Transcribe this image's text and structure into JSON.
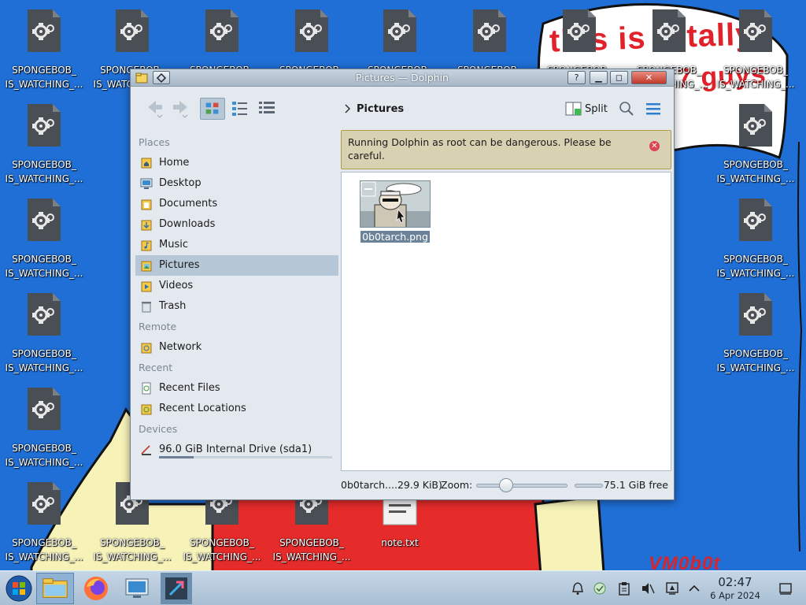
{
  "wallpaper": {
    "scrawl_top": "this is totally",
    "scrawl_mid": "",
    "scrawl_second": "7 guys",
    "signature": "VM0b0t"
  },
  "desktop": {
    "icons": [
      {
        "label": "SPONGEBOB_\nIS_WATCHING_...",
        "kind": "file-gear"
      },
      {
        "label": "SPONGEBOB_\nIS_WATCHING_...",
        "kind": "file-gear"
      },
      {
        "label": "SPONGEBOB_\nIS_WATCHING_...",
        "kind": "file-gear"
      },
      {
        "label": "SPONGEBOB_\nIS_WATCHING_...",
        "kind": "file-gear"
      },
      {
        "label": "SPONGEBOB_\nIS_WATCHING_...",
        "kind": "file-gear"
      },
      {
        "label": "SPONGEBOB_\nIS_WATCHING_...",
        "kind": "file-gear"
      },
      {
        "label": "SPONGEBOB_\nIS_WATCHING_...",
        "kind": "file-gear"
      },
      {
        "label": "SPONGEBOB_\nIS_WATCHING_...",
        "kind": "file-gear"
      },
      {
        "label": "SPONGEBOB_\nIS_WATCHING_...",
        "kind": "file-gear"
      },
      {
        "label": "SPONGEBOB_\nIS_WATCHING_...",
        "kind": "file-gear"
      },
      {
        "label": "SPONGEBOB_\nIS_WATCHING_...",
        "kind": "file-gear"
      },
      {
        "label": "SPONGEBOB_\nIS_WATCHING_...",
        "kind": "file-gear"
      },
      {
        "label": "SPONGEBOB_\nIS_WATCHING_...",
        "kind": "file-gear"
      },
      {
        "label": "SPONGEBOB_\nIS_WATCHING_...",
        "kind": "file-gear"
      },
      {
        "label": "SPONGEBOB_\nIS_WATCHING_...",
        "kind": "file-gear"
      },
      {
        "label": "SPONGEBOB_\nIS_WATCHING_...",
        "kind": "file-gear"
      },
      {
        "label": "SPONGEBOB_\nIS_WATCHING_...",
        "kind": "file-gear"
      },
      {
        "label": "SPONGEBOB_\nIS_WATCHING_...",
        "kind": "file-gear"
      },
      {
        "label": "SPONGEBOB_\nIS_WATCHING_...",
        "kind": "file-gear"
      },
      {
        "label": "SPONGEBOB_\nIS_WATCHING_...",
        "kind": "file-gear"
      },
      {
        "label": "note.txt",
        "kind": "text-file"
      }
    ]
  },
  "window": {
    "title": "Pictures — Dolphin",
    "buttons": {
      "help": "?",
      "minimize": "▁",
      "maximize": "◻",
      "close": "✕"
    }
  },
  "toolbar": {
    "breadcrumb": "Pictures",
    "split_label": "Split",
    "icons": [
      "back-icon",
      "forward-icon",
      "icons-view-icon",
      "compact-view-icon",
      "details-view-icon",
      "split-icon",
      "search-icon",
      "menu-icon"
    ]
  },
  "places": {
    "groups": [
      {
        "title": "Places",
        "items": [
          {
            "label": "Home",
            "icon": "home-icon"
          },
          {
            "label": "Desktop",
            "icon": "desktop-icon"
          },
          {
            "label": "Documents",
            "icon": "documents-folder-icon"
          },
          {
            "label": "Downloads",
            "icon": "downloads-folder-icon"
          },
          {
            "label": "Music",
            "icon": "music-folder-icon"
          },
          {
            "label": "Pictures",
            "icon": "pictures-folder-icon",
            "selected": true
          },
          {
            "label": "Videos",
            "icon": "videos-folder-icon"
          },
          {
            "label": "Trash",
            "icon": "trash-icon"
          }
        ]
      },
      {
        "title": "Remote",
        "items": [
          {
            "label": "Network",
            "icon": "network-folder-icon"
          }
        ]
      },
      {
        "title": "Recent",
        "items": [
          {
            "label": "Recent Files",
            "icon": "recent-files-icon"
          },
          {
            "label": "Recent Locations",
            "icon": "recent-locations-icon"
          }
        ]
      },
      {
        "title": "Devices",
        "items": [
          {
            "label": "96.0 GiB Internal Drive (sda1)",
            "icon": "drive-icon",
            "usage_fraction": 0.2
          }
        ]
      }
    ]
  },
  "banner": {
    "message": "Running Dolphin as root can be dangerous. Please be careful.",
    "color": "#d8d1b2"
  },
  "files": [
    {
      "name": "0b0tarch.png"
    }
  ],
  "statusbar": {
    "selection": "0b0tarch....29.9 KiB)",
    "zoom_label": "Zoom:",
    "zoom_fraction": 0.3,
    "free_space": "75.1 GiB free"
  },
  "taskbar": {
    "apps": [
      "start-menu-icon",
      "file-manager-icon",
      "firefox-icon",
      "system-settings-icon",
      "discover-icon"
    ],
    "tray": [
      "notifications-icon",
      "clipboard-icon",
      "klipper-icon",
      "volume-muted-icon",
      "monitor-icon",
      "expand-tray-icon"
    ],
    "clock_time": "02:47",
    "clock_date": "6 Apr 2024",
    "show_desktop": "show-desktop-icon"
  },
  "colors": {
    "wallpaper_blue": "#1f6fd6",
    "wallpaper_red": "#e62b2b",
    "wallpaper_yellow": "#f6f2b8",
    "selection": "#b6c8d8"
  }
}
